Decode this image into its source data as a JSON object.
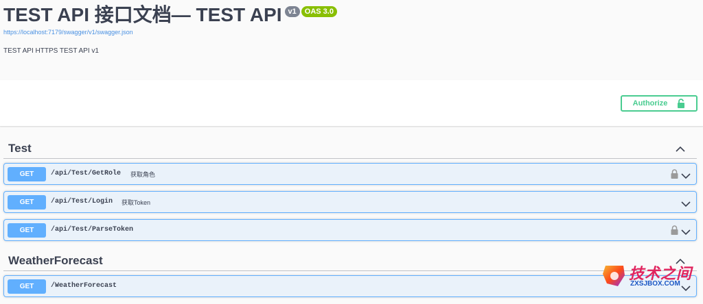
{
  "info": {
    "title": "TEST API 接口文档— TEST API",
    "version_badge": "v1",
    "oas_badge": "OAS 3.0",
    "spec_url": "https://localhost:7179/swagger/v1/swagger.json",
    "description": "TEST API HTTPS TEST API v1"
  },
  "auth": {
    "authorize_label": "Authorize"
  },
  "tags": [
    {
      "name": "Test",
      "operations": [
        {
          "method": "GET",
          "path": "/api/Test/GetRole",
          "summary": "获取角色",
          "locked": true
        },
        {
          "method": "GET",
          "path": "/api/Test/Login",
          "summary": "获取Token",
          "locked": false
        },
        {
          "method": "GET",
          "path": "/api/Test/ParseToken",
          "summary": "",
          "locked": true
        }
      ]
    },
    {
      "name": "WeatherForecast",
      "operations": [
        {
          "method": "GET",
          "path": "/WeatherForecast",
          "summary": "",
          "locked": false
        }
      ]
    }
  ],
  "watermark": {
    "text_cn": "技术之间",
    "text_en": "ZXSJBOX.COM"
  },
  "colors": {
    "get": "#61affe",
    "authorize": "#49cc90",
    "oas": "#89bf04",
    "version": "#7d8492"
  }
}
